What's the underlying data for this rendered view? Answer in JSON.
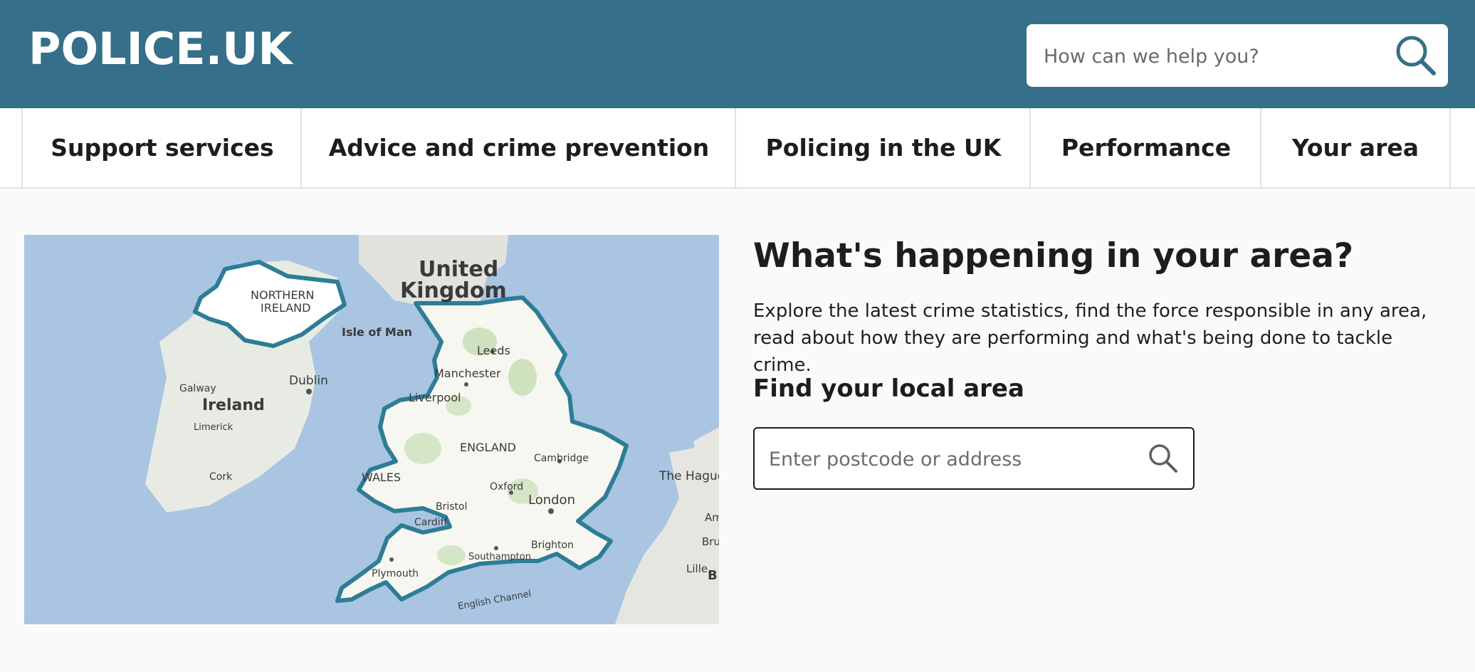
{
  "header": {
    "logo": "POLICE.UK",
    "search_placeholder": "How can we help you?",
    "search_icon": "search-icon"
  },
  "nav": {
    "items": [
      {
        "label": "Support services"
      },
      {
        "label": "Advice and crime prevention"
      },
      {
        "label": "Policing in the UK"
      },
      {
        "label": "Performance"
      },
      {
        "label": "Your area"
      }
    ]
  },
  "map": {
    "labels": {
      "united": "United",
      "kingdom": "Kingdom",
      "northern": "NORTHERN",
      "ireland_ni": "IRELAND",
      "isle_of_man": "Isle of Man",
      "leeds": "Leeds",
      "manchester": "Manchester",
      "liverpool": "Liverpool",
      "dublin": "Dublin",
      "galway": "Galway",
      "ireland": "Ireland",
      "limerick": "Limerick",
      "cork": "Cork",
      "england": "ENGLAND",
      "cambridge": "Cambridge",
      "wales": "WALES",
      "oxford": "Oxford",
      "london": "London",
      "bristol": "Bristol",
      "cardiff": "Cardiff",
      "the_hague": "The Hague",
      "brighton": "Brighton",
      "southampton": "Southampton",
      "plymouth": "Plymouth",
      "english_channel": "English Channel",
      "am": "Am",
      "bru": "Bru",
      "lille": "Lille",
      "b": "B"
    },
    "colors": {
      "sea": "#a9c5e1",
      "land": "#f4f4ef",
      "border": "#2e7d96"
    }
  },
  "content": {
    "heading": "What's happening in your area?",
    "description": "Explore the latest crime statistics, find the force responsible in any area, read about how they are performing and what's being done to tackle crime.",
    "subheading": "Find your local area",
    "search_placeholder": "Enter postcode or address",
    "search_icon": "search-icon"
  },
  "colors": {
    "header_bg": "#356f89",
    "page_bg": "#fafafa",
    "nav_border": "#e3e3e3"
  }
}
